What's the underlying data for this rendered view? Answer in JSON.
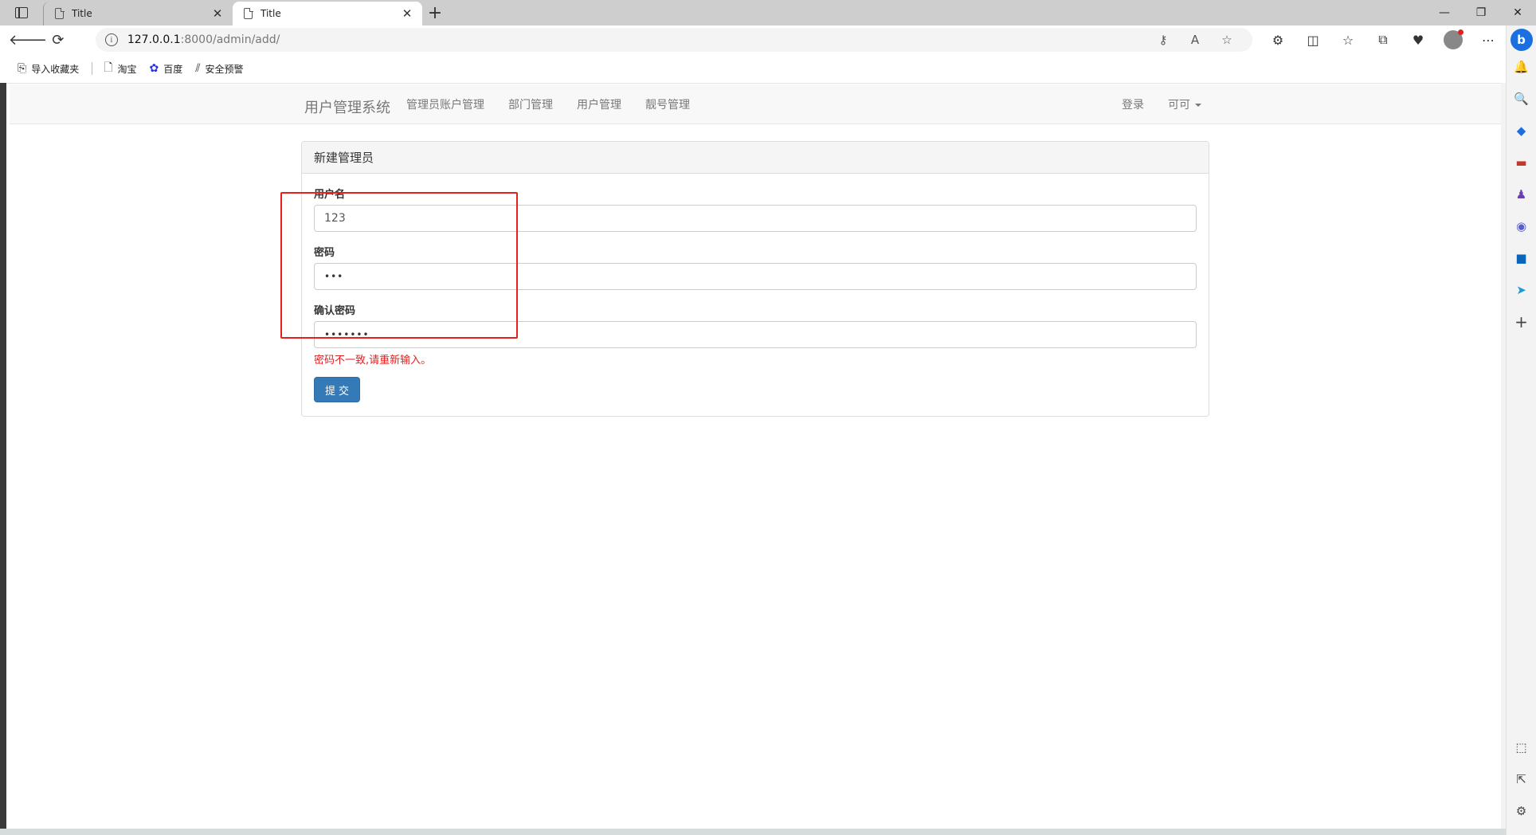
{
  "browser": {
    "tabs": [
      {
        "label": "Title",
        "active": false
      },
      {
        "label": "Title",
        "active": true
      }
    ],
    "new_tab": "+",
    "window_controls": [
      "—",
      "❐",
      "✕"
    ],
    "url_host": "127.0.0.1",
    "url_path": ":8000/admin/add/",
    "favorites": [
      {
        "label": "导入收藏夹",
        "icon": "import-icon"
      },
      {
        "label": "淘宝",
        "icon": "document-icon"
      },
      {
        "label": "百度",
        "icon": "baidu-paw-icon"
      },
      {
        "label": "安全预警",
        "icon": "security-alert-icon"
      }
    ]
  },
  "navbar": {
    "brand": "用户管理系统",
    "links": [
      "管理员账户管理",
      "部门管理",
      "用户管理",
      "靓号管理"
    ],
    "login": "登录",
    "user": "可可"
  },
  "form": {
    "title": "新建管理员",
    "username_label": "用户名",
    "username_value": "123",
    "password_label": "密码",
    "password_value": "•••",
    "confirm_label": "确认密码",
    "confirm_value": "•••••••",
    "error_message": "密码不一致,请重新输入。",
    "submit_label": "提交"
  },
  "colors": {
    "primary": "#337ab7",
    "error": "#e02020",
    "annotation": "#e8201c"
  }
}
